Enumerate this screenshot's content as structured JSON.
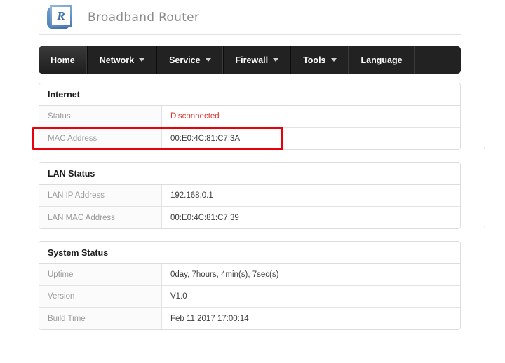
{
  "brand": {
    "logo_icon": "router-logo-icon",
    "logo_letter": "R",
    "title": "Broadband Router"
  },
  "nav": {
    "items": [
      {
        "label": "Home",
        "has_caret": false,
        "active": true
      },
      {
        "label": "Network",
        "has_caret": true,
        "active": false
      },
      {
        "label": "Service",
        "has_caret": true,
        "active": false
      },
      {
        "label": "Firewall",
        "has_caret": true,
        "active": false
      },
      {
        "label": "Tools",
        "has_caret": true,
        "active": false
      },
      {
        "label": "Language",
        "has_caret": false,
        "active": false
      }
    ]
  },
  "panels": [
    {
      "title": "Internet",
      "rows": [
        {
          "label": "Status",
          "value": "Disconnected",
          "status": "bad"
        },
        {
          "label": "MAC Address",
          "value": "00:E0:4C:81:C7:3A",
          "status": ""
        }
      ]
    },
    {
      "title": "LAN Status",
      "rows": [
        {
          "label": "LAN IP Address",
          "value": "192.168.0.1",
          "status": ""
        },
        {
          "label": "LAN MAC Address",
          "value": "00:E0:4C:81:C7:39",
          "status": ""
        }
      ]
    },
    {
      "title": "System Status",
      "rows": [
        {
          "label": "Uptime",
          "value": "0day, 7hours, 4min(s), 7sec(s)",
          "status": ""
        },
        {
          "label": "Version",
          "value": "V1.0",
          "status": ""
        },
        {
          "label": "Build Time",
          "value": "Feb 11 2017 17:00:14",
          "status": ""
        }
      ]
    }
  ],
  "annotation": {
    "name": "mac-address-highlight",
    "color": "#e8000a",
    "targets_row_label": "MAC Address"
  },
  "colors": {
    "navbar_bg": "#222222",
    "status_error": "#d9332b",
    "panel_border": "#dddddd",
    "label_text": "#9b9b9b",
    "value_text": "#3d3d3d",
    "brand_text": "#8a8a8a",
    "logo_blue": "#3b6ea5"
  }
}
